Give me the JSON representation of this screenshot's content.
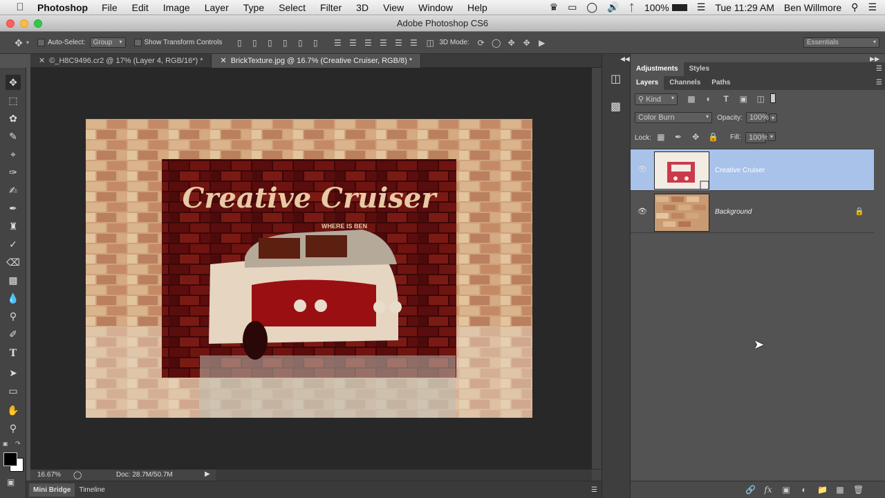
{
  "menubar": {
    "app_name": "Photoshop",
    "items": [
      "File",
      "Edit",
      "Image",
      "Layer",
      "Type",
      "Select",
      "Filter",
      "3D",
      "View",
      "Window",
      "Help"
    ],
    "battery": "100%",
    "clock": "Tue 11:29 AM",
    "user": "Ben Willmore"
  },
  "window": {
    "title": "Adobe Photoshop CS6"
  },
  "options": {
    "auto_select_label": "Auto-Select:",
    "auto_select_value": "Group",
    "transform_label": "Show Transform Controls",
    "mode_3d_label": "3D Mode:",
    "workspace": "Essentials"
  },
  "doc_tabs": [
    {
      "label": "©_H8C9496.cr2 @ 17% (Layer 4, RGB/16*) *"
    },
    {
      "label": "BrickTexture.jpg @ 16.7% (Creative Cruiser, RGB/8) *"
    }
  ],
  "artwork": {
    "title": "Creative Cruiser",
    "subtitle": "WHERE IS BEN"
  },
  "status": {
    "zoom": "16.67%",
    "doc": "Doc: 28.7M/50.7M"
  },
  "bottom_tabs": [
    "Mini Bridge",
    "Timeline"
  ],
  "adj_tabs": [
    "Adjustments",
    "Styles"
  ],
  "layer_tabs": [
    "Layers",
    "Channels",
    "Paths"
  ],
  "layers_panel": {
    "kind": "Kind",
    "blend_mode": "Color Burn",
    "opacity_label": "Opacity:",
    "opacity": "100%",
    "lock_label": "Lock:",
    "fill_label": "Fill:",
    "fill": "100%",
    "layers": [
      {
        "name": "Creative Cruiser",
        "selected": true
      },
      {
        "name": "Background",
        "selected": false
      }
    ]
  }
}
